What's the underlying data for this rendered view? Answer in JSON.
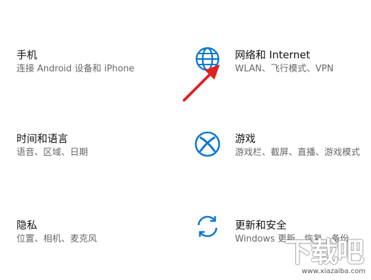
{
  "settings": {
    "phone": {
      "title": "手机",
      "desc": "连接 Android 设备和 iPhone",
      "icon": "phone-icon"
    },
    "network": {
      "title": "网络和 Internet",
      "desc": "WLAN、飞行模式、VPN",
      "icon": "globe-icon"
    },
    "time_language": {
      "title": "时间和语言",
      "desc": "语音、区域、日期",
      "icon": "clock-language-icon"
    },
    "gaming": {
      "title": "游戏",
      "desc": "游戏栏、截屏、直播、游戏模式",
      "icon": "xbox-icon"
    },
    "privacy": {
      "title": "隐私",
      "desc": "位置、相机、麦克风",
      "icon": "lock-icon"
    },
    "update_security": {
      "title": "更新和安全",
      "desc": "Windows 更新、恢复、备份",
      "icon": "sync-icon"
    }
  },
  "accent_color": "#0a78d4",
  "annotation_arrow_color": "#e02020",
  "watermark": {
    "glyphs": "下载吧",
    "url": "www.xiazaiba.com"
  }
}
